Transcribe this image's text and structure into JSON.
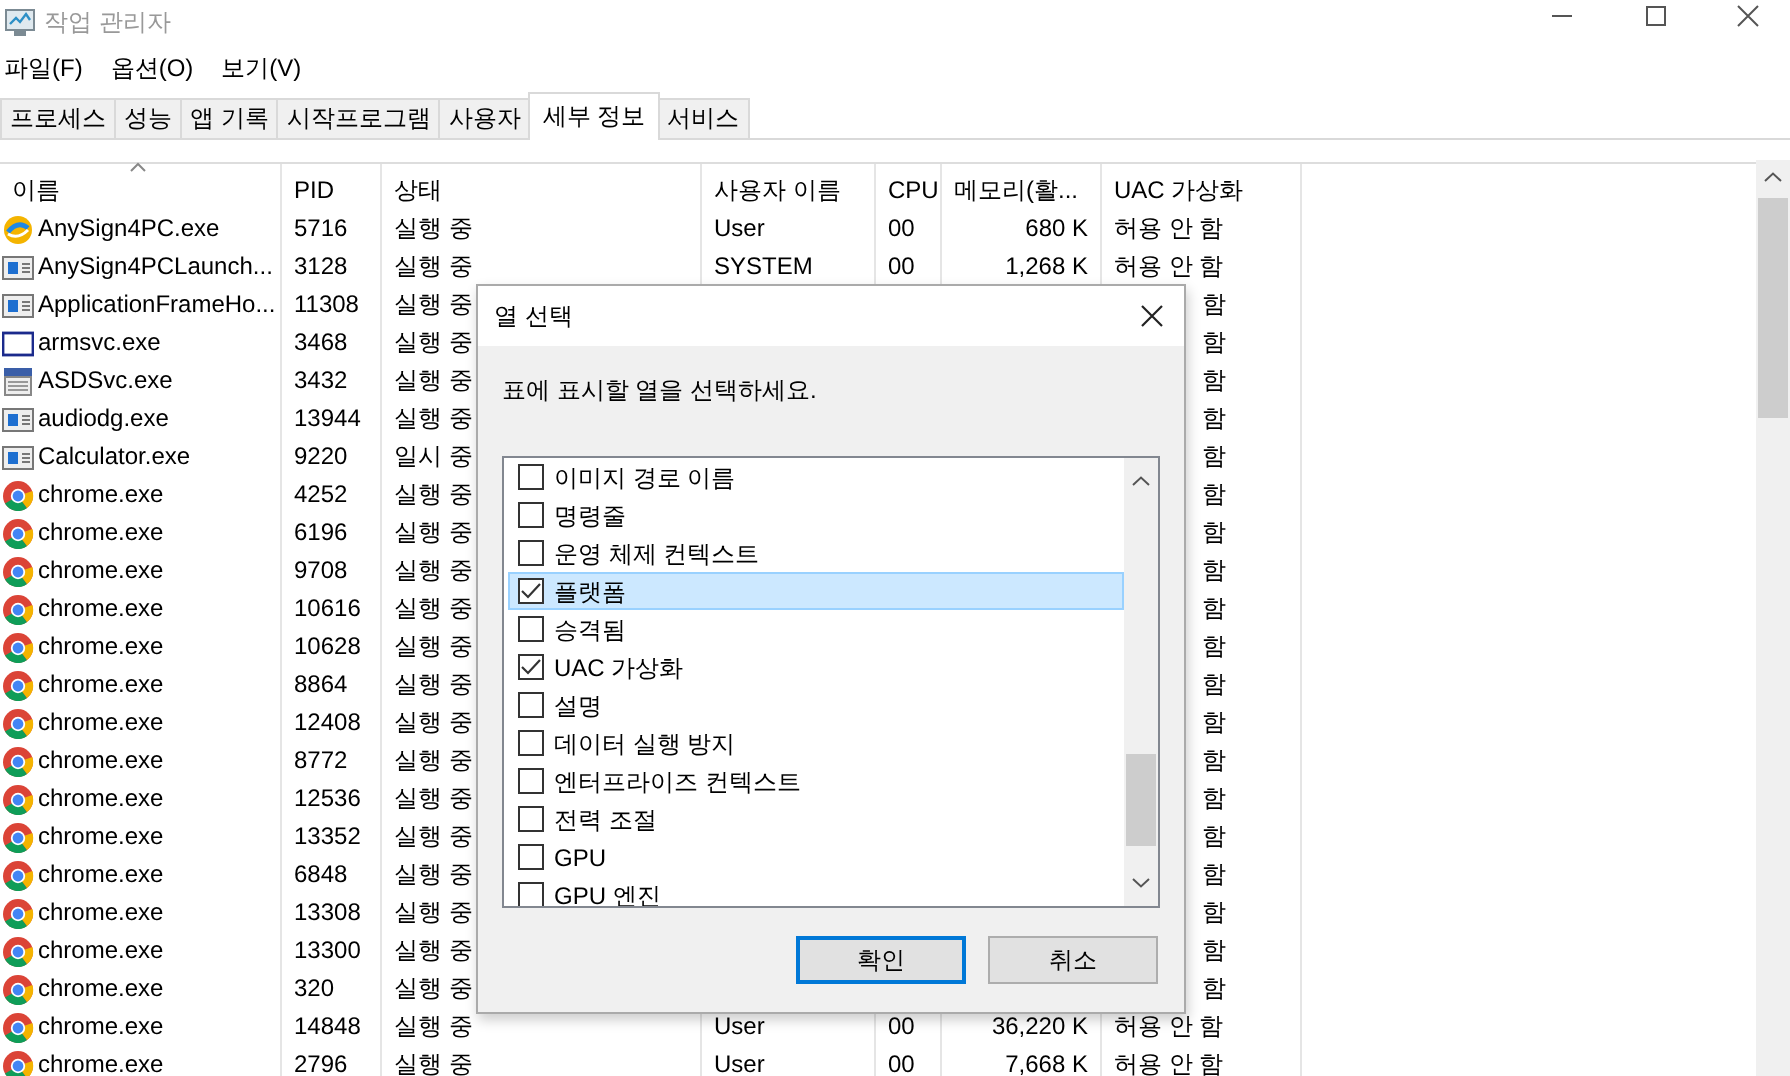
{
  "window": {
    "title": "작업 관리자"
  },
  "menu": [
    "파일(F)",
    "옵션(O)",
    "보기(V)"
  ],
  "tabs": [
    {
      "label": "프로세스",
      "selected": false
    },
    {
      "label": "성능",
      "selected": false
    },
    {
      "label": "앱 기록",
      "selected": false
    },
    {
      "label": "시작프로그램",
      "selected": false
    },
    {
      "label": "사용자",
      "selected": false
    },
    {
      "label": "세부 정보",
      "selected": true
    },
    {
      "label": "서비스",
      "selected": false
    }
  ],
  "table": {
    "columns": [
      {
        "label": "이름",
        "sorted": true
      },
      {
        "label": "PID",
        "sorted": false
      },
      {
        "label": "상태",
        "sorted": false
      },
      {
        "label": "사용자 이름",
        "sorted": false
      },
      {
        "label": "CPU",
        "sorted": false
      },
      {
        "label": "메모리(활...",
        "sorted": false
      },
      {
        "label": "UAC 가상화",
        "sorted": false
      }
    ],
    "rows": [
      {
        "kind": "anysign",
        "name": "AnySign4PC.exe",
        "pid": "5716",
        "status": "실행 중",
        "user": "User",
        "cpu": "00",
        "memory": "680 K",
        "uac": "허용 안 함"
      },
      {
        "kind": "app",
        "name": "AnySign4PCLaunch...",
        "pid": "3128",
        "status": "실행 중",
        "user": "SYSTEM",
        "cpu": "00",
        "memory": "1,268 K",
        "uac": "허용 안 함"
      },
      {
        "kind": "app",
        "name": "ApplicationFrameHo...",
        "pid": "11308",
        "status": "실행 중",
        "uac": "함"
      },
      {
        "kind": "window",
        "name": "armsvc.exe",
        "pid": "3468",
        "status": "실행 중",
        "uac": "함"
      },
      {
        "kind": "service",
        "name": "ASDSvc.exe",
        "pid": "3432",
        "status": "실행 중",
        "uac": "함"
      },
      {
        "kind": "app",
        "name": "audiodg.exe",
        "pid": "13944",
        "status": "실행 중",
        "uac": "함"
      },
      {
        "kind": "app",
        "name": "Calculator.exe",
        "pid": "9220",
        "status": "일시 중",
        "uac": "함"
      },
      {
        "kind": "chrome",
        "name": "chrome.exe",
        "pid": "4252",
        "status": "실행 중",
        "uac": "함"
      },
      {
        "kind": "chrome",
        "name": "chrome.exe",
        "pid": "6196",
        "status": "실행 중",
        "uac": "함"
      },
      {
        "kind": "chrome",
        "name": "chrome.exe",
        "pid": "9708",
        "status": "실행 중",
        "uac": "함"
      },
      {
        "kind": "chrome",
        "name": "chrome.exe",
        "pid": "10616",
        "status": "실행 중",
        "uac": "함"
      },
      {
        "kind": "chrome",
        "name": "chrome.exe",
        "pid": "10628",
        "status": "실행 중",
        "uac": "함"
      },
      {
        "kind": "chrome",
        "name": "chrome.exe",
        "pid": "8864",
        "status": "실행 중",
        "uac": "함"
      },
      {
        "kind": "chrome",
        "name": "chrome.exe",
        "pid": "12408",
        "status": "실행 중",
        "uac": "함"
      },
      {
        "kind": "chrome",
        "name": "chrome.exe",
        "pid": "8772",
        "status": "실행 중",
        "uac": "함"
      },
      {
        "kind": "chrome",
        "name": "chrome.exe",
        "pid": "12536",
        "status": "실행 중",
        "uac": "함"
      },
      {
        "kind": "chrome",
        "name": "chrome.exe",
        "pid": "13352",
        "status": "실행 중",
        "uac": "함"
      },
      {
        "kind": "chrome",
        "name": "chrome.exe",
        "pid": "6848",
        "status": "실행 중",
        "uac": "함"
      },
      {
        "kind": "chrome",
        "name": "chrome.exe",
        "pid": "13308",
        "status": "실행 중",
        "uac": "함"
      },
      {
        "kind": "chrome",
        "name": "chrome.exe",
        "pid": "13300",
        "status": "실행 중",
        "uac": "함"
      },
      {
        "kind": "chrome",
        "name": "chrome.exe",
        "pid": "320",
        "status": "실행 중",
        "uac": "함"
      },
      {
        "kind": "chrome",
        "name": "chrome.exe",
        "pid": "14848",
        "status": "실행 중",
        "user": "User",
        "cpu": "00",
        "memory": "36,220 K",
        "uac": "허용 안 함"
      },
      {
        "kind": "chrome",
        "name": "chrome.exe",
        "pid": "2796",
        "status": "실행 중",
        "user": "User",
        "cpu": "00",
        "memory": "7,668 K",
        "uac": "허용 안 함"
      }
    ]
  },
  "dialog": {
    "title": "열 선택",
    "prompt": "표에 표시할 열을 선택하세요.",
    "options": [
      {
        "label": "이미지 경로 이름",
        "checked": false,
        "selected": false
      },
      {
        "label": "명령줄",
        "checked": false,
        "selected": false
      },
      {
        "label": "운영 체제 컨텍스트",
        "checked": false,
        "selected": false
      },
      {
        "label": "플랫폼",
        "checked": true,
        "selected": true
      },
      {
        "label": "승격됨",
        "checked": false,
        "selected": false
      },
      {
        "label": "UAC 가상화",
        "checked": true,
        "selected": false
      },
      {
        "label": "설명",
        "checked": false,
        "selected": false
      },
      {
        "label": "데이터 실행 방지",
        "checked": false,
        "selected": false
      },
      {
        "label": "엔터프라이즈 컨텍스트",
        "checked": false,
        "selected": false
      },
      {
        "label": "전력 조절",
        "checked": false,
        "selected": false
      },
      {
        "label": "GPU",
        "checked": false,
        "selected": false
      },
      {
        "label": "GPU 엔진",
        "checked": false,
        "selected": false
      }
    ],
    "buttons": [
      {
        "label": "확인",
        "default": true
      },
      {
        "label": "취소",
        "default": false
      }
    ]
  }
}
